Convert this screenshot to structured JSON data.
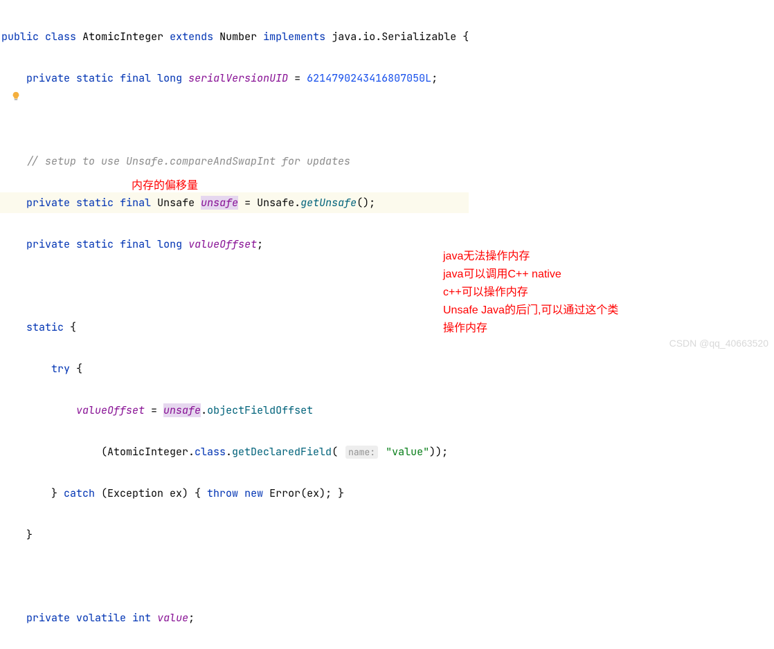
{
  "code": {
    "l1": {
      "kw1": "public",
      "kw2": "class",
      "cls1": "AtomicInteger",
      "kw3": "extends",
      "cls2": "Number",
      "kw4": "implements",
      "pkg": "java.io.Serializable",
      "brace": " {"
    },
    "l2": {
      "indent": "    ",
      "kw1": "private",
      "kw2": "static",
      "kw3": "final",
      "kw4": "long",
      "fld": "serialVersionUID",
      "eq": " = ",
      "num": "6214790243416807050L",
      "semi": ";"
    },
    "l4": {
      "indent": "    ",
      "cmt": "// setup to use Unsafe.compareAndSwapInt for updates"
    },
    "l5": {
      "indent": "    ",
      "kw1": "private",
      "kw2": "static",
      "kw3": "final",
      "cls": "Unsafe ",
      "fld": "unsafe",
      "eq": " = Unsafe.",
      "mth": "getUnsafe",
      "tail": "();"
    },
    "l6": {
      "indent": "    ",
      "kw1": "private",
      "kw2": "static",
      "kw3": "final",
      "kw4": "long",
      "fld": "valueOffset",
      "semi": ";"
    },
    "l8": {
      "indent": "    ",
      "kw": "static",
      "brace": " {"
    },
    "l9": {
      "indent": "        ",
      "kw": "try",
      "brace": " {"
    },
    "l10": {
      "indent": "            ",
      "fld1": "valueOffset",
      "eq": " = ",
      "fld2": "unsafe",
      "dot": ".",
      "mth": "objectFieldOffset"
    },
    "l11": {
      "indent": "                (AtomicInteger.",
      "kw": "class",
      "dot": ".",
      "mth": "getDeclaredField",
      "open": "( ",
      "hint": "name:",
      "sp": " ",
      "str": "\"value\"",
      "close": "));"
    },
    "l12": {
      "indent": "        } ",
      "kw1": "catch",
      "open": " (Exception ex) { ",
      "kw2": "throw",
      "kw3": "new",
      "err": " Error(ex); }"
    },
    "l13": {
      "indent": "    }"
    },
    "l15": {
      "indent": "    ",
      "kw1": "private",
      "kw2": "volatile",
      "kw3": "int",
      "fld": "value",
      "semi": ";"
    }
  },
  "annotations": {
    "a1": "内存的偏移量",
    "a2_l1": "java无法操作内存",
    "a2_l2": "java可以调用C++ native",
    "a2_l3": "c++可以操作内存",
    "a2_l4": "Unsafe Java的后门,可以通过这个类",
    "a2_l5": "操作内存"
  },
  "watermark": "CSDN @qq_40663520"
}
